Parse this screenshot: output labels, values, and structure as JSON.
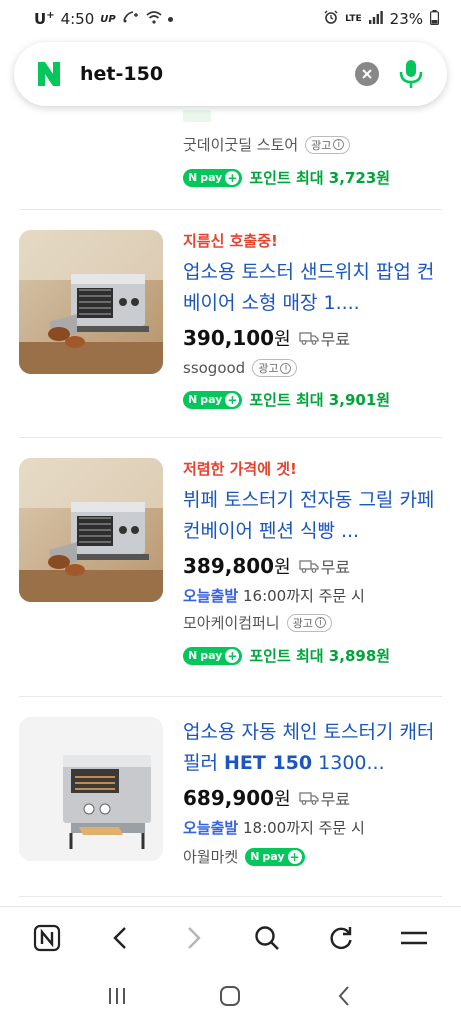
{
  "status_bar": {
    "carrier": "U",
    "carrier_sup": "+",
    "time": "4:50",
    "up_label": "UP",
    "lte": "LTE",
    "battery": "23%"
  },
  "search": {
    "query": "het-150",
    "logo_letter": "N"
  },
  "partial_result": {
    "store": "굿데이굿딜 스토어",
    "ad_label": "광고",
    "npay_label": "pay",
    "points": "포인트 최대 3,723원"
  },
  "results": [
    {
      "promo": "지름신 호출중!",
      "title": "업소용 토스터 샌드위치 팝업 컨베이어 소형 매장 1....",
      "price": "390,100",
      "won": "원",
      "shipping": "무료",
      "store": "ssogood",
      "ad_label": "광고",
      "npay_label": "pay",
      "points": "포인트 최대 3,901원"
    },
    {
      "promo": "저렴한 가격에 겟!",
      "title": "뷔페 토스터기 전자동 그릴 카페 컨베이어 펜션 식빵 ...",
      "price": "389,800",
      "won": "원",
      "shipping": "무료",
      "today_label": "오늘출발",
      "today_text": "16:00까지 주문 시",
      "store": "모아케이컴퍼니",
      "ad_label": "광고",
      "npay_label": "pay",
      "points": "포인트 최대 3,898원"
    },
    {
      "title_pre": "업소용 자동 체인 토스터기 캐터필러 ",
      "title_bold": "HET 150",
      "title_post": " 1300...",
      "price": "689,900",
      "won": "원",
      "shipping": "무료",
      "today_label": "오늘출발",
      "today_text": "18:00까지 주문 시",
      "store": "아월마켓",
      "npay_label": "pay"
    }
  ],
  "colors": {
    "link_blue": "#1a56c0",
    "promo_red": "#e5432d",
    "naver_green": "#03c75a",
    "today_blue": "#3562e2"
  }
}
